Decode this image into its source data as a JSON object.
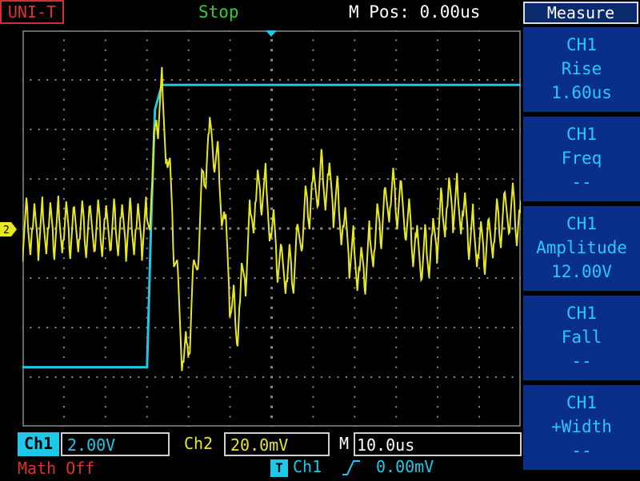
{
  "header": {
    "brand": "UNI-T",
    "run_status": "Stop",
    "mpos": "M Pos: 0.00us"
  },
  "menu": {
    "title": "Measure",
    "items": [
      {
        "channel": "CH1",
        "name": "Rise",
        "value": "1.60us"
      },
      {
        "channel": "CH1",
        "name": "Freq",
        "value": "--"
      },
      {
        "channel": "CH1",
        "name": "Amplitude",
        "value": "12.00V"
      },
      {
        "channel": "CH1",
        "name": "Fall",
        "value": "--"
      },
      {
        "channel": "CH1",
        "name": "+Width",
        "value": "--"
      }
    ]
  },
  "status": {
    "ch1_label": "Ch1",
    "ch1_scale": "2.00V",
    "ch2_label": "Ch2",
    "ch2_scale": "20.0mV",
    "time_label": "M",
    "time_scale": "10.0us",
    "math": "Math Off",
    "trigger_badge": "T",
    "trigger_source": "Ch1",
    "trigger_level": "0.00mV"
  },
  "colors": {
    "ch1": "#20c8e8",
    "ch2": "#e8e820",
    "grid": "#8a8a8a",
    "accent_red": "#e03030",
    "menu_bg": "#0a2f88"
  },
  "icons": {
    "trigger_edge": "rising-edge-icon",
    "channel_marker": "channel-marker-icon",
    "trigger_position": "trigger-position-icon"
  },
  "chart_data": {
    "type": "line",
    "grid": true,
    "x_divisions": 12,
    "y_divisions": 8,
    "series": [
      {
        "name": "Ch1",
        "shape": "step",
        "x": [
          0,
          25,
          25.8,
          26.6,
          28,
          100
        ],
        "y": [
          -2.8,
          -2.8,
          0,
          2.4,
          2.9,
          2.9
        ]
      },
      {
        "name": "Ch2",
        "x": [
          0,
          25,
          26,
          27,
          28,
          29,
          30,
          31,
          32,
          33,
          34,
          35,
          36,
          37,
          38,
          39,
          40,
          41,
          42,
          43,
          44,
          45,
          46,
          47,
          48,
          49,
          50,
          52,
          54,
          56,
          58,
          60,
          62,
          64,
          66,
          68,
          70,
          72,
          74,
          76,
          78,
          80,
          82,
          84,
          86,
          88,
          90,
          92,
          94,
          96,
          98,
          100
        ],
        "y": [
          0,
          0,
          0.8,
          2.4,
          2.6,
          1.6,
          0.4,
          -1.0,
          -2.4,
          -2.7,
          -1.4,
          -0.6,
          0.6,
          1.6,
          1.9,
          1.3,
          0.6,
          -0.4,
          -1.6,
          -2.0,
          -1.2,
          -0.6,
          0.3,
          0.6,
          0.9,
          0.6,
          0.0,
          -0.8,
          -0.9,
          0.0,
          0.7,
          1.0,
          0.8,
          0.2,
          -0.5,
          -0.9,
          -0.4,
          0.2,
          0.7,
          0.5,
          -0.1,
          -0.6,
          -0.4,
          0.2,
          0.6,
          0.4,
          -0.1,
          -0.4,
          -0.2,
          0.2,
          0.4,
          0.1
        ],
        "noise_amplitude": 0.55,
        "noise_period": 1.6
      }
    ]
  }
}
